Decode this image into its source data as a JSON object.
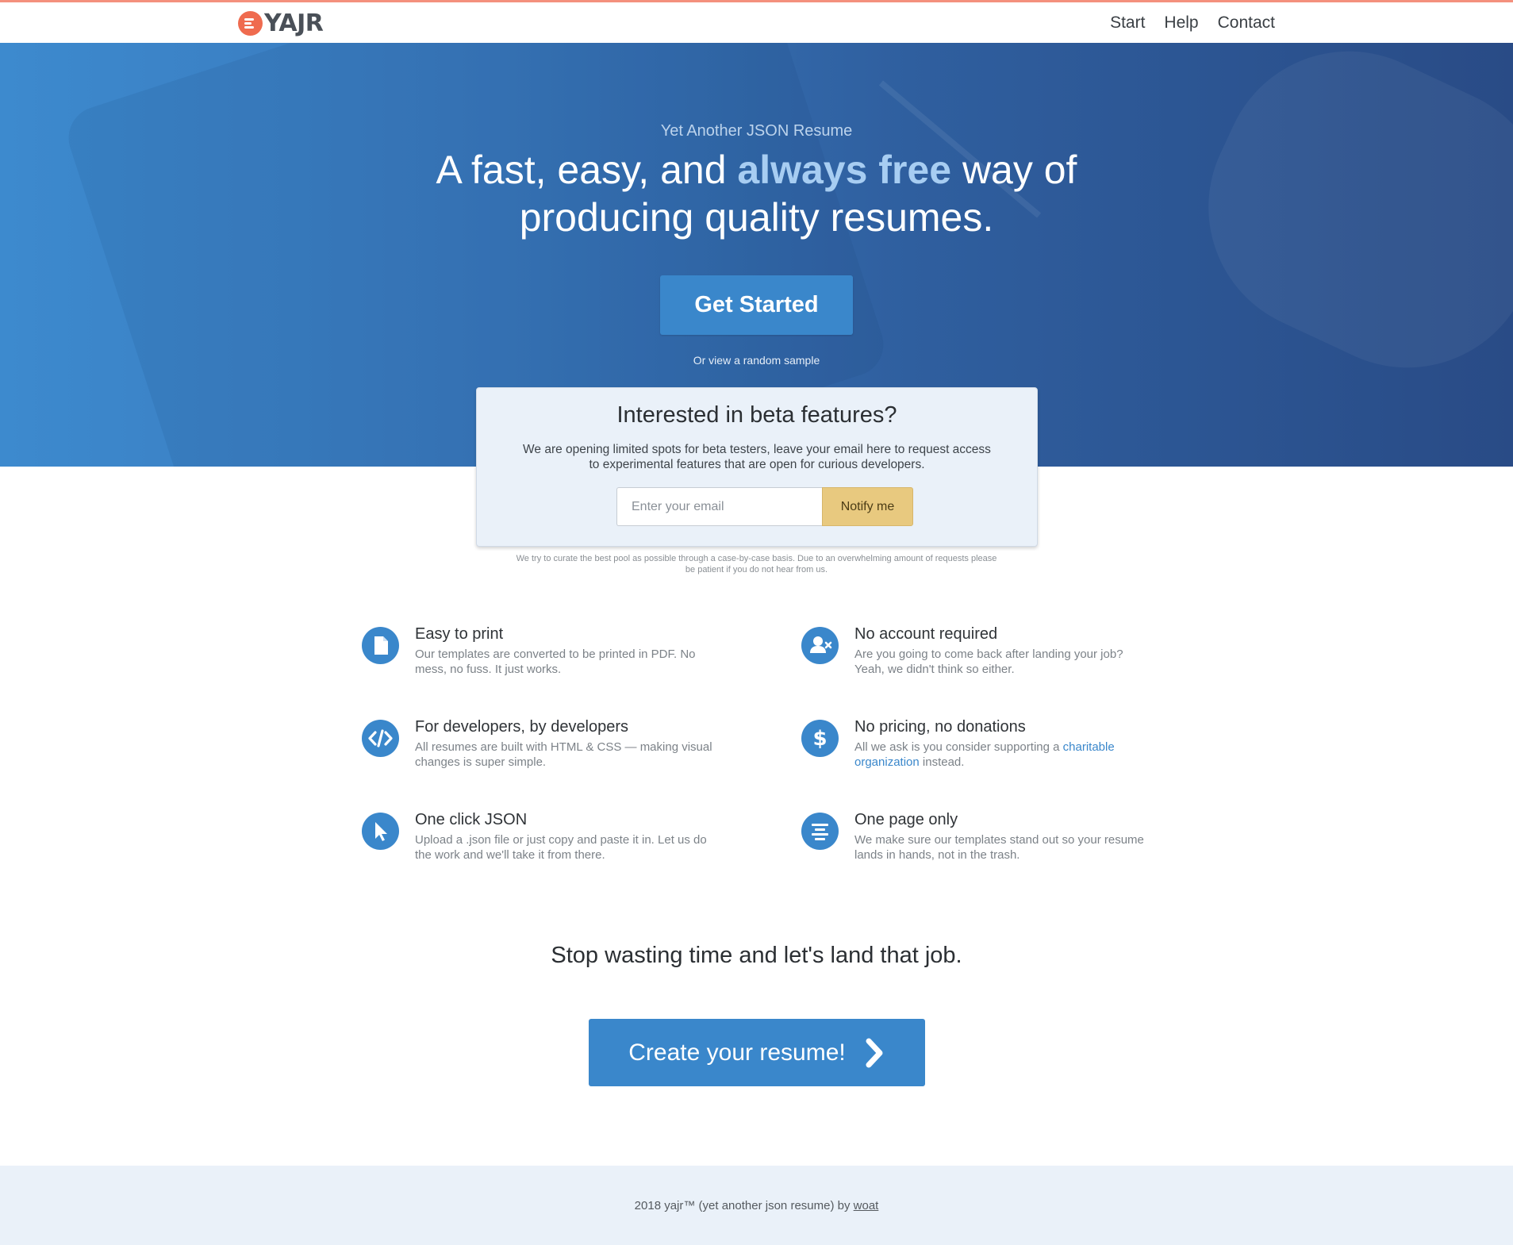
{
  "nav": {
    "brand": "YAJR",
    "links": [
      "Start",
      "Help",
      "Contact"
    ]
  },
  "hero": {
    "eyebrow": "Yet Another JSON Resume",
    "headline_part1": "A fast, easy, and ",
    "headline_highlight": "always free",
    "headline_part2": " way of",
    "headline_line2": "producing quality resumes.",
    "cta_label": "Get Started",
    "sample_link": "Or view a random sample"
  },
  "beta": {
    "title": "Interested in beta features?",
    "text": "We are opening limited spots for beta testers, leave your email here to request access to experimental features that are open for curious developers.",
    "email_placeholder": "Enter your email",
    "button_label": "Notify me",
    "fine_print": "We try to curate the best pool as possible through a case-by-case basis. Due to an overwhelming amount of requests please be patient if you do not hear from us."
  },
  "features": [
    {
      "title": "Easy to print",
      "text": "Our templates are converted to be printed in PDF. No mess, no fuss. It just works.",
      "icon": "document-icon"
    },
    {
      "title": "No account required",
      "text": "Are you going to come back after landing your job? Yeah, we didn't think so either.",
      "icon": "user-remove-icon"
    },
    {
      "title": "For developers, by developers",
      "text": "All resumes are built with HTML & CSS — making visual changes is super simple.",
      "icon": "code-icon"
    },
    {
      "title": "No pricing, no donations",
      "text_before": "All we ask is you consider supporting a ",
      "link": "charitable organization",
      "text_after": " instead.",
      "icon": "dollar-icon"
    },
    {
      "title": "One click JSON",
      "text": "Upload a .json file or just copy and paste it in. Let us do the work and we'll take it from there.",
      "icon": "cursor-icon"
    },
    {
      "title": "One page only",
      "text": "We make sure our templates stand out so your resume lands in hands, not in the trash.",
      "icon": "align-center-icon"
    }
  ],
  "tagline": "Stop wasting time and let's land that job.",
  "create_button": "Create your resume!",
  "footer": {
    "text": "2018 yajr™ (yet another json resume) by ",
    "link": "woat"
  },
  "colors": {
    "accent_blue": "#3a87cb",
    "logo_orange": "#ef6b4f",
    "notify_yellow": "#e8c97f",
    "top_line": "#f4907d"
  }
}
